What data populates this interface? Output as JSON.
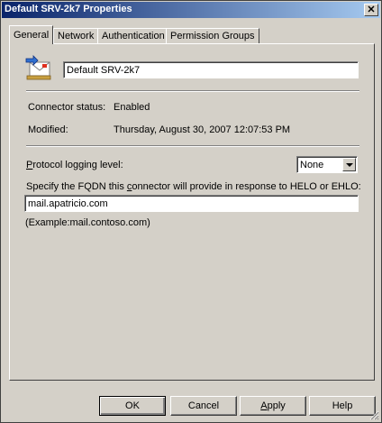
{
  "window": {
    "title": "Default SRV-2k7 Properties",
    "close_glyph": "✕"
  },
  "tabs": [
    {
      "label": "General",
      "active": true
    },
    {
      "label": "Network",
      "active": false
    },
    {
      "label": "Authentication",
      "active": false
    },
    {
      "label": "Permission Groups",
      "active": false
    }
  ],
  "general": {
    "connector_name": "Default SRV-2k7",
    "status_label": "Connector status:",
    "status_value": "Enabled",
    "modified_label": "Modified:",
    "modified_value": "Thursday, August 30, 2007 12:07:53 PM",
    "logging_label_accel": "P",
    "logging_label_rest": "rotocol logging level:",
    "logging_value": "None",
    "fqdn_label_pre": "Specify the FQDN this ",
    "fqdn_label_accel": "c",
    "fqdn_label_post": "onnector will provide in response to HELO or EHLO:",
    "fqdn_value": "mail.apatricio.com",
    "example": "(Example:mail.contoso.com)"
  },
  "buttons": {
    "ok": "OK",
    "cancel": "Cancel",
    "apply_accel": "A",
    "apply_rest": "pply",
    "help": "Help"
  },
  "icons": {
    "connector": "send-connector-icon",
    "dropdown": "chevron-down-icon",
    "grip": "resize-grip-icon"
  }
}
